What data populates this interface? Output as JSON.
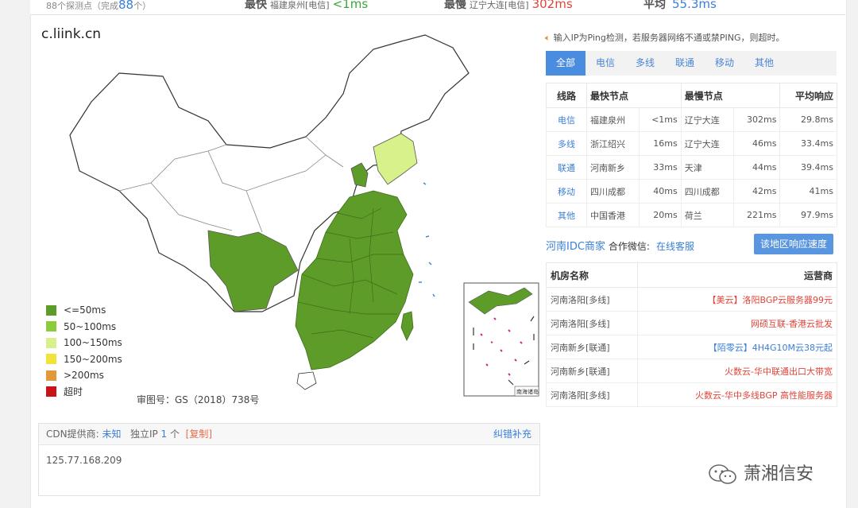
{
  "stats": {
    "count_prefix": "88个探测点（完成",
    "done": "88",
    "count_suffix": "个）",
    "fastest_label": "最快",
    "fastest_loc": "福建泉州[电信]",
    "fastest_val": "<1ms",
    "slowest_label": "最慢",
    "slowest_loc": "辽宁大连[电信]",
    "slowest_val": "302ms",
    "avg_label": "平均",
    "avg_val": "55.3ms"
  },
  "domain": "c.liink.cn",
  "legend": [
    {
      "label": "<=50ms",
      "color": "#5e9c2a"
    },
    {
      "label": "50~100ms",
      "color": "#8bcb3c"
    },
    {
      "label": "100~150ms",
      "color": "#d7f28a"
    },
    {
      "label": "150~200ms",
      "color": "#f0e43a"
    },
    {
      "label": ">200ms",
      "color": "#e09a3a"
    },
    {
      "label": "超时",
      "color": "#c81414"
    }
  ],
  "approval": "审图号：GS（2018）738号",
  "inset_label": "南海诸岛",
  "cdn": {
    "provider_label": "CDN提供商:",
    "provider": "未知",
    "ip_label": "独立IP",
    "ip_count": "1",
    "ip_unit": "个",
    "copy": "[复制]",
    "fix": "纠错补充",
    "ip": "125.77.168.209"
  },
  "notice": "输入IP为Ping检测，若服务器网络不通或禁PING，则超时。",
  "tabs": [
    "全部",
    "电信",
    "多线",
    "联通",
    "移动",
    "其他"
  ],
  "speed_table": {
    "headers": [
      "线路",
      "最快节点",
      "最慢节点",
      "平均响应"
    ],
    "rows": [
      {
        "line": "电信",
        "fast": "福建泉州",
        "fast_ms": "<1ms",
        "slow": "辽宁大连",
        "slow_ms": "302ms",
        "avg": "29.8ms"
      },
      {
        "line": "多线",
        "fast": "浙江绍兴",
        "fast_ms": "16ms",
        "slow": "辽宁大连",
        "slow_ms": "46ms",
        "avg": "33.4ms"
      },
      {
        "line": "联通",
        "fast": "河南新乡",
        "fast_ms": "33ms",
        "slow": "天津",
        "slow_ms": "44ms",
        "avg": "39.4ms"
      },
      {
        "line": "移动",
        "fast": "四川成都",
        "fast_ms": "40ms",
        "slow": "四川成都",
        "slow_ms": "42ms",
        "avg": "41ms"
      },
      {
        "line": "其他",
        "fast": "中国香港",
        "fast_ms": "20ms",
        "slow": "荷兰",
        "slow_ms": "221ms",
        "avg": "97.9ms"
      }
    ]
  },
  "ad": {
    "title": "河南IDC商家",
    "wechat": "合作微信:",
    "service": "在线客服",
    "button": "该地区响应速度"
  },
  "idc_table": {
    "headers": [
      "机房名称",
      "运营商"
    ],
    "rows": [
      {
        "room": "河南洛阳[多线]",
        "op": "【美云】洛阳BGP云服务器99元",
        "color": "red"
      },
      {
        "room": "河南洛阳[多线]",
        "op": "网硕互联-香港云批发",
        "color": "red"
      },
      {
        "room": "河南新乡[联通]",
        "op": "【陌零云】4H4G10M云38元起",
        "color": "blue"
      },
      {
        "room": "河南新乡[联通]",
        "op": "火数云-华中联通出口大带宽",
        "color": "red"
      },
      {
        "room": "河南洛阳[多线]",
        "op": "火数云-华中多线BGP 高性能服务器",
        "color": "red"
      }
    ]
  },
  "watermark": "萧湘信安"
}
